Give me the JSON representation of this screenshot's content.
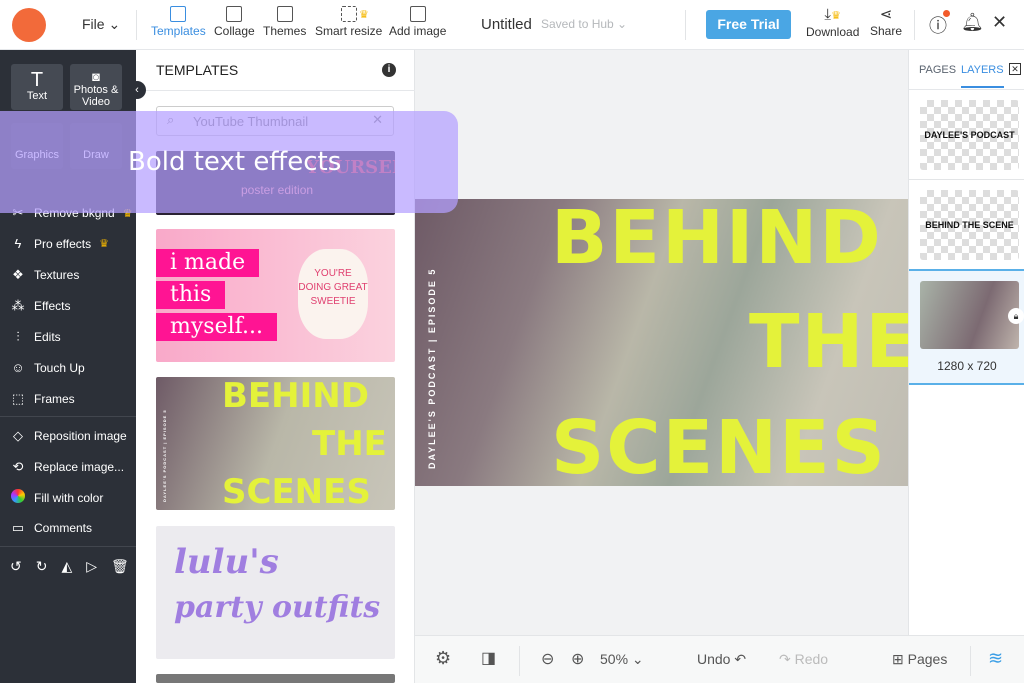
{
  "header": {
    "file": "File",
    "tools": [
      {
        "label": "Templates"
      },
      {
        "label": "Collage"
      },
      {
        "label": "Themes"
      },
      {
        "label": "Smart resize"
      },
      {
        "label": "Add image"
      }
    ],
    "title": "Untitled",
    "saved": "Saved to Hub",
    "free_trial": "Free Trial",
    "download": "Download",
    "share": "Share"
  },
  "left": {
    "tiles": [
      "Text",
      "Photos & Video",
      "Graphics",
      "Draw"
    ],
    "items": [
      "Remove bkgnd",
      "Pro effects",
      "Textures",
      "Effects",
      "Edits",
      "Touch Up",
      "Frames",
      "Reposition image",
      "Replace image...",
      "Fill with color",
      "Comments"
    ]
  },
  "templates": {
    "heading": "TEMPLATES",
    "search_placeholder": "YouTube Thumbnail",
    "t1": [
      "YOURSELF",
      "poster edition"
    ],
    "t2": [
      "i made",
      "this",
      "myself...",
      "YOU'RE DOING GREAT SWEETIE"
    ],
    "t3": [
      "BEHIND",
      "THE",
      "SCENES",
      "DAYLEE'S PODCAST | EPISODE 5"
    ],
    "t4": [
      "lulu's",
      "party outfits"
    ]
  },
  "canvas": {
    "lines": [
      "BEHIND",
      "THE",
      "SCENES"
    ],
    "vertical": "DAYLEE'S PODCAST | EPISODE 5"
  },
  "right": {
    "tabs": [
      "PAGES",
      "LAYERS"
    ],
    "layers": [
      "DAYLEE'S PODCAST",
      "BEHIND THE SCENE"
    ],
    "image_size": "1280 x 720"
  },
  "bottom": {
    "zoom": "50%",
    "undo": "Undo",
    "redo": "Redo",
    "pages": "Pages"
  },
  "banner": "Bold text effects"
}
